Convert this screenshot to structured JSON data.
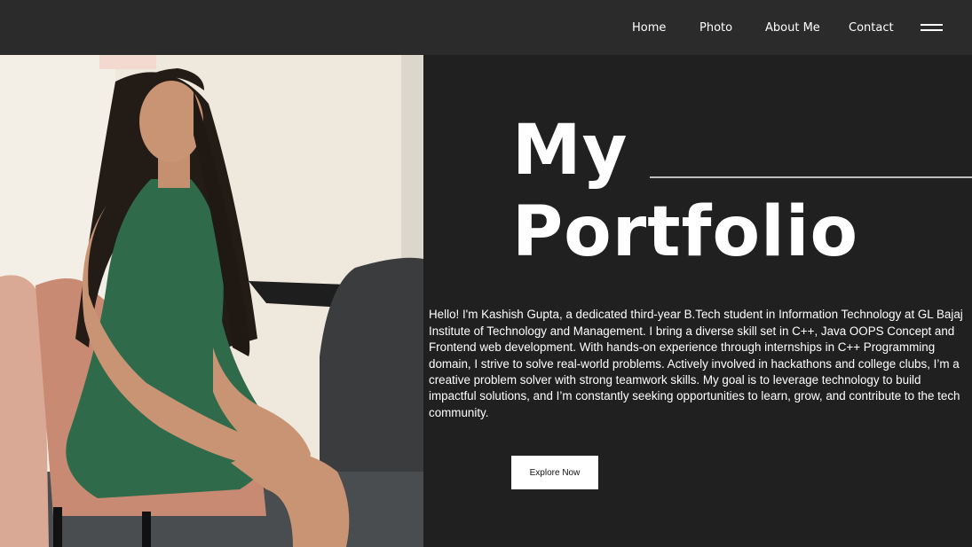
{
  "nav": {
    "links": [
      {
        "label": "Home"
      },
      {
        "label": "Photo"
      },
      {
        "label": "About Me"
      },
      {
        "label": "Contact"
      }
    ],
    "menu_icon": "hamburger-menu-icon"
  },
  "hero": {
    "photo_description_icon": "portrait-photo",
    "title_line1": "My",
    "title_line2": "Portfolio",
    "bio": "Hello! I'm Kashish Gupta, a dedicated third-year B.Tech student in Information Technology at GL Bajaj Institute of Technology and Management. I bring a diverse skill set in C++, Java OOPS Concept and Frontend web development. With hands-on experience through internships in C++ Programming domain, I strive to solve real-world problems. Actively involved in hackathons and college clubs, I’m a creative problem solver with strong teamwork skills. My goal is to leverage technology to build impactful solutions, and I’m constantly seeking opportunities to learn, grow, and contribute to the tech community.",
    "cta_label": "Explore Now"
  },
  "colors": {
    "navbar_bg": "#2b2b2b",
    "page_bg": "#202020",
    "text": "#ffffff",
    "dress": "#2f6a4a"
  }
}
